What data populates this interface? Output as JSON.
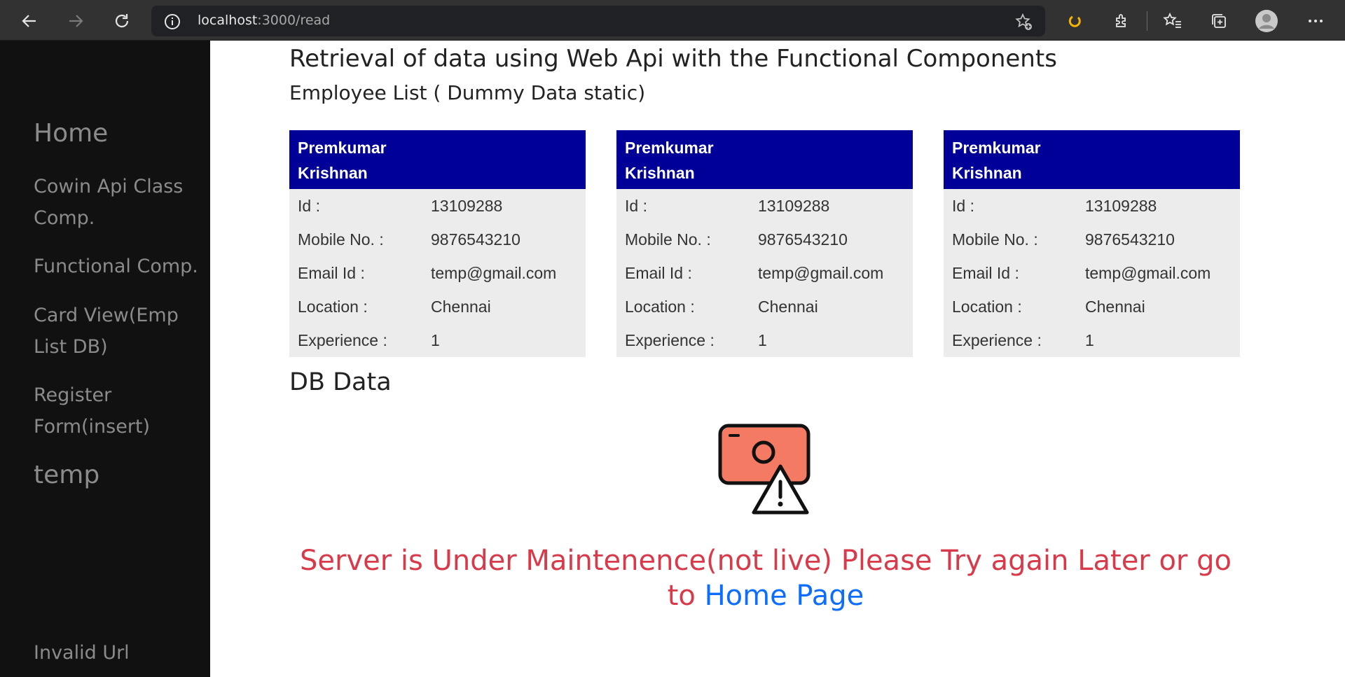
{
  "browser": {
    "url_host": "localhost",
    "url_path": ":3000/read"
  },
  "sidebar": {
    "items": [
      {
        "label": "Home"
      },
      {
        "label": "Cowin Api Class Comp."
      },
      {
        "label": "Functional Comp."
      },
      {
        "label": "Card View(Emp List DB)"
      },
      {
        "label": "Register Form(insert)"
      },
      {
        "label": "temp"
      },
      {
        "label": "Invalid Url"
      }
    ]
  },
  "main": {
    "title": "Retrieval of data using Web Api with the Functional Components",
    "subtitle": "Employee List ( Dummy Data static)",
    "field_labels": {
      "id": "Id :",
      "mobile": "Mobile No. :",
      "email": "Email Id :",
      "location": "Location :",
      "experience": "Experience :"
    },
    "cards": [
      {
        "name_first": "Premkumar",
        "name_last": "Krishnan",
        "id": "13109288",
        "mobile": "9876543210",
        "email": "temp@gmail.com",
        "location": "Chennai",
        "experience": "1"
      },
      {
        "name_first": "Premkumar",
        "name_last": "Krishnan",
        "id": "13109288",
        "mobile": "9876543210",
        "email": "temp@gmail.com",
        "location": "Chennai",
        "experience": "1"
      },
      {
        "name_first": "Premkumar",
        "name_last": "Krishnan",
        "id": "13109288",
        "mobile": "9876543210",
        "email": "temp@gmail.com",
        "location": "Chennai",
        "experience": "1"
      }
    ],
    "db_heading": "DB Data",
    "error_text": "Server is Under Maintenence(not live) Please Try again Later or go to ",
    "home_link": "Home Page"
  },
  "colors": {
    "card_header": "#000099",
    "error": "#d93a4a",
    "link": "#0d6efd"
  }
}
